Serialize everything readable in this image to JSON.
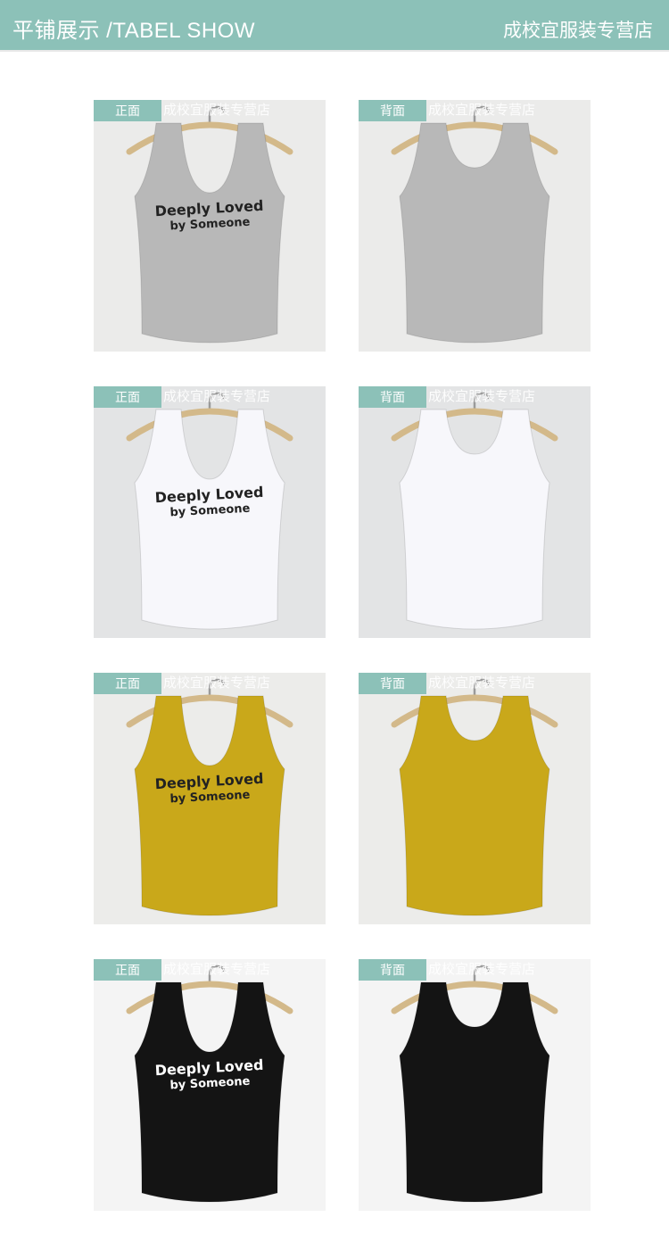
{
  "header": {
    "title": "平铺展示 /TABEL SHOW",
    "shop": "成校宜服装专营店"
  },
  "slogan": {
    "line1": "Deeply Loved",
    "line2": "by Someone"
  },
  "rows": [
    {
      "color": "gray",
      "front": {
        "tag": "正面",
        "watermark": "成校宜服装专营店"
      },
      "back": {
        "tag": "背面",
        "watermark": "成校宜服装专营店"
      },
      "shirt_color": "#b8b8b8",
      "bg_color": "#ebebea",
      "print_color": "#222222"
    },
    {
      "color": "white",
      "front": {
        "tag": "正面",
        "watermark": "成校宜服装专营店"
      },
      "back": {
        "tag": "背面",
        "watermark": "成校宜服装专营店"
      },
      "shirt_color": "#f7f7fb",
      "bg_color": "#e3e4e5",
      "print_color": "#222222"
    },
    {
      "color": "mustard",
      "front": {
        "tag": "正面",
        "watermark": "成校宜服装专营店"
      },
      "back": {
        "tag": "背面",
        "watermark": "成校宜服装专营店"
      },
      "shirt_color": "#c9a81a",
      "bg_color": "#ececea",
      "print_color": "#222222"
    },
    {
      "color": "black",
      "front": {
        "tag": "正面",
        "watermark": "成校宜服装专营店"
      },
      "back": {
        "tag": "背面",
        "watermark": "成校宜服装专营店"
      },
      "shirt_color": "#141414",
      "bg_color": "#f4f4f4",
      "print_color": "#ffffff"
    }
  ]
}
